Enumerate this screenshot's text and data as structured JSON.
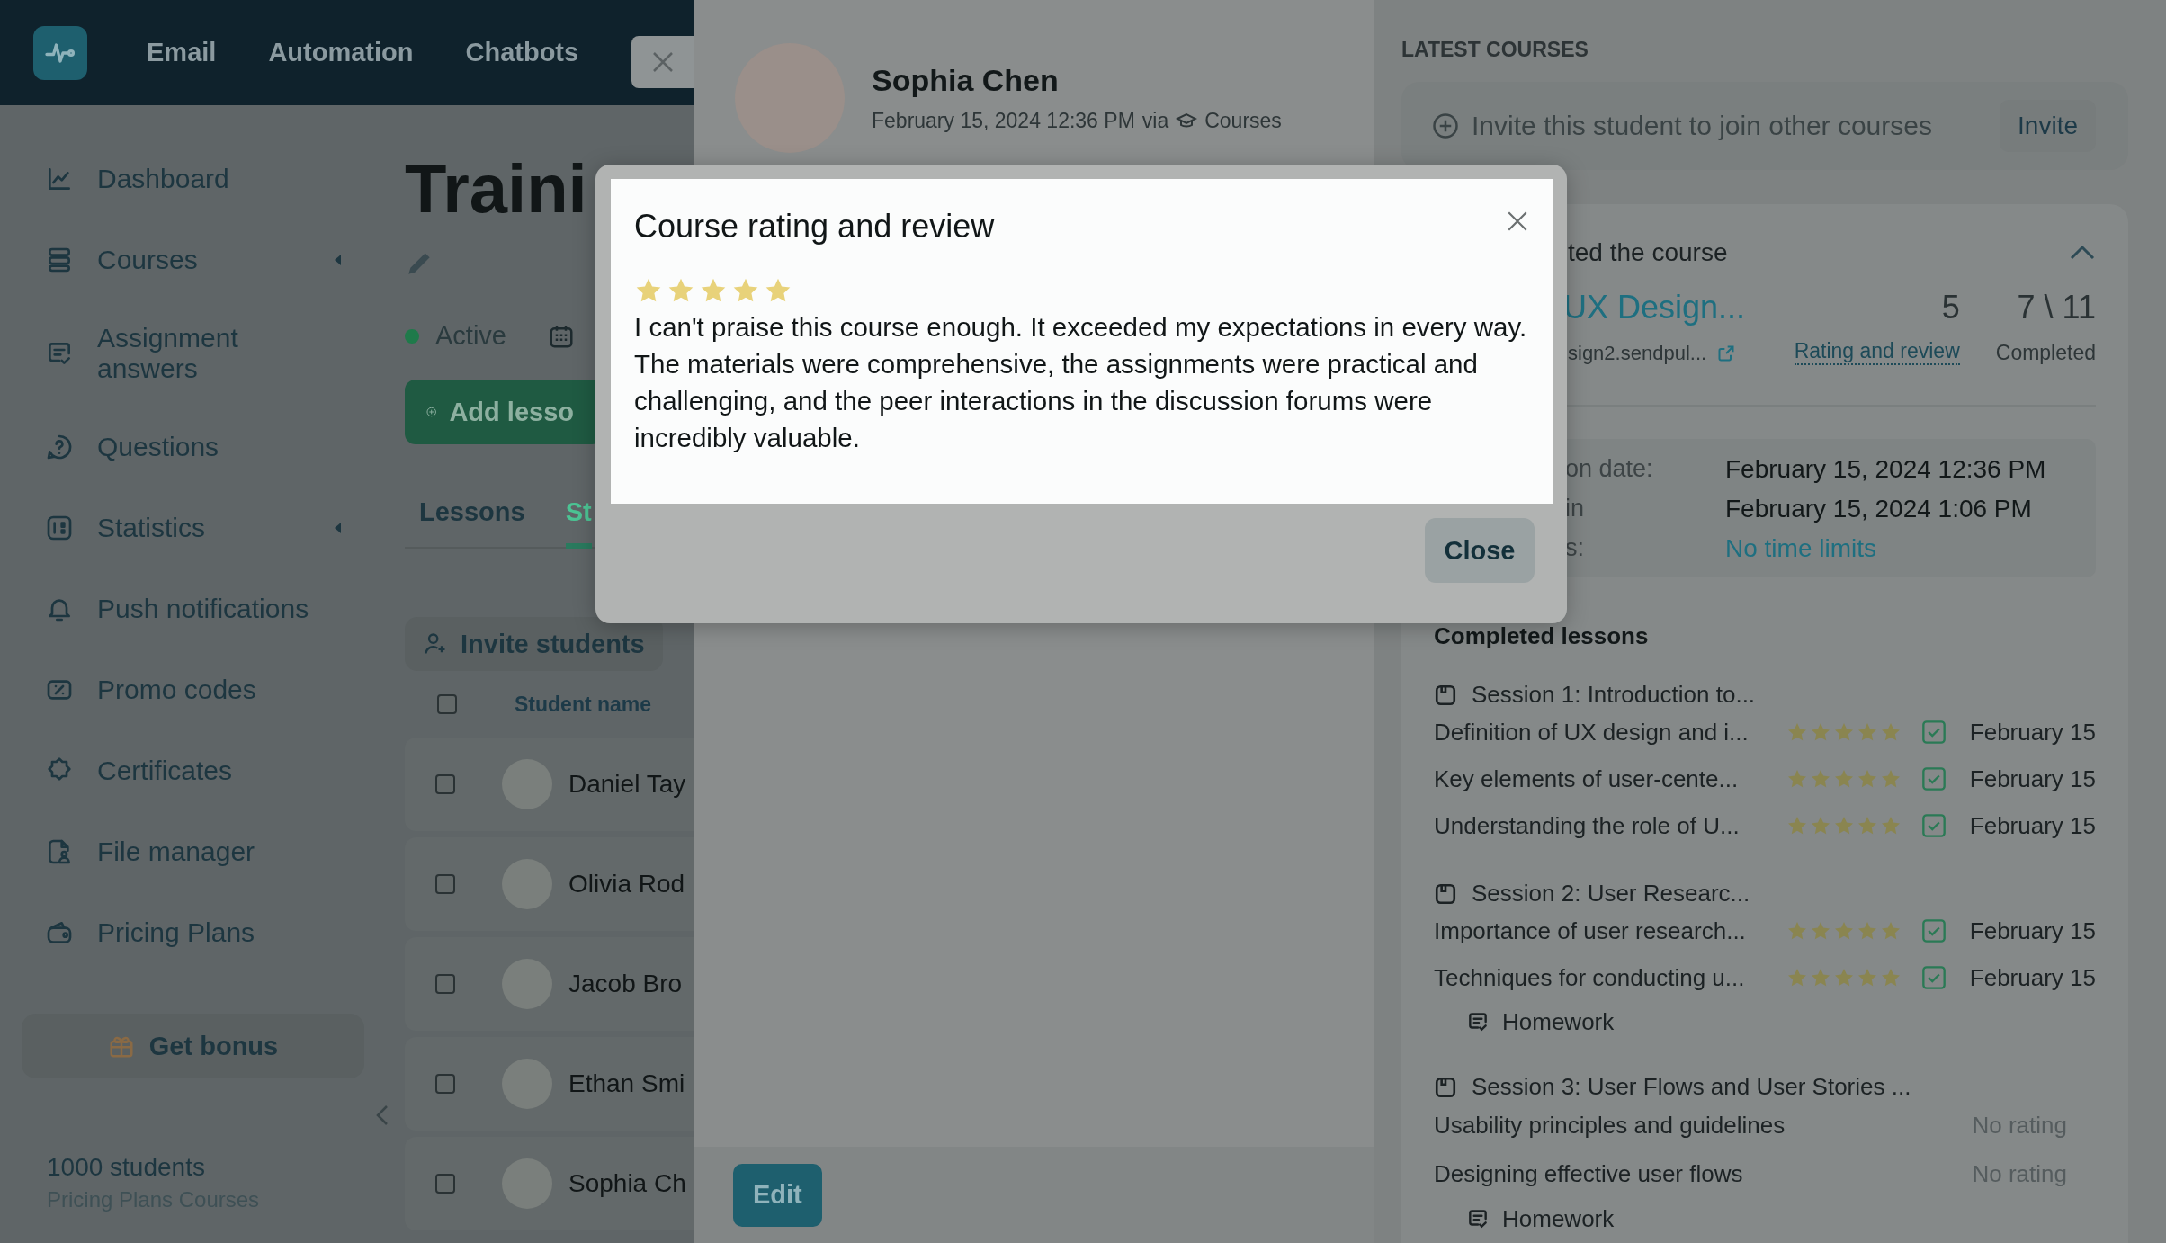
{
  "top_nav": {
    "items": [
      {
        "label": "Email"
      },
      {
        "label": "Automation"
      },
      {
        "label": "Chatbots"
      }
    ]
  },
  "sidebar": {
    "items": [
      {
        "label": "Dashboard",
        "expandable": false
      },
      {
        "label": "Courses",
        "expandable": true
      },
      {
        "label": "Assignment answers",
        "expandable": false
      },
      {
        "label": "Questions",
        "expandable": false
      },
      {
        "label": "Statistics",
        "expandable": true
      },
      {
        "label": "Push notifications",
        "expandable": false
      },
      {
        "label": "Promo codes",
        "expandable": false
      },
      {
        "label": "Certificates",
        "expandable": false
      },
      {
        "label": "File manager",
        "expandable": false
      },
      {
        "label": "Pricing Plans",
        "expandable": false
      }
    ],
    "bonus_button": "Get bonus",
    "footer": {
      "count": "1000 students",
      "plan": "Pricing Plans Courses"
    }
  },
  "course": {
    "title": "Traini",
    "status": "Active",
    "add_button": "Add lesso",
    "tabs": [
      {
        "label": "Lessons",
        "selected": false
      },
      {
        "label": "St",
        "selected": true
      }
    ],
    "invite_button": "Invite students",
    "table": {
      "header_checked": false,
      "columns": [
        "Student name"
      ],
      "rows": [
        {
          "name": "Daniel Tay",
          "checked": false
        },
        {
          "name": "Olivia Rod",
          "checked": false
        },
        {
          "name": "Jacob Bro",
          "checked": false
        },
        {
          "name": "Ethan Smi",
          "checked": false
        },
        {
          "name": "Sophia Ch",
          "checked": false
        }
      ]
    }
  },
  "student_panel": {
    "name": "Sophia Chen",
    "date": "February 15, 2024 12:36 PM",
    "via": "via",
    "source": "Courses",
    "edit_button": "Edit",
    "latest_courses": {
      "heading": "LATEST COURSES",
      "invite_text": "Invite this student to join other courses",
      "invite_button": "Invite",
      "course": {
        "status_text": "ted the course",
        "expanded": true,
        "name": "UX Design...",
        "link": "sign2.sendpul...",
        "rating": "5",
        "rating_label": "Rating and review",
        "progress": "7 \\ 11",
        "progress_label": "Completed",
        "details": [
          {
            "label": "on date:",
            "value": "February 15, 2024 12:36 PM",
            "kind": "text"
          },
          {
            "label": "in",
            "value": "February 15, 2024 1:06 PM",
            "kind": "text"
          },
          {
            "label": "s:",
            "value": "No time limits",
            "kind": "link"
          }
        ],
        "completed_heading": "Completed lessons",
        "sessions": [
          {
            "title": "Session 1: Introduction to...",
            "children": [
              {
                "kind": "rated",
                "title": "Definition of UX design and i...",
                "stars": 5,
                "checked": true,
                "date": "February 15"
              },
              {
                "kind": "rated",
                "title": "Key elements of user-cente...",
                "stars": 5,
                "checked": true,
                "date": "February 15"
              },
              {
                "kind": "rated",
                "title": "Understanding the role of U...",
                "stars": 5,
                "checked": true,
                "date": "February 15"
              }
            ]
          },
          {
            "title": "Session 2: User Researc...",
            "children": [
              {
                "kind": "rated",
                "title": "Importance of user research...",
                "stars": 5,
                "checked": true,
                "date": "February 15"
              },
              {
                "kind": "rated",
                "title": "Techniques for conducting u...",
                "stars": 5,
                "checked": true,
                "date": "February 15"
              },
              {
                "kind": "homework",
                "title": "Homework"
              }
            ]
          },
          {
            "title": "Session 3: User Flows and User Stories ...",
            "children": [
              {
                "kind": "unrated",
                "title": "Usability principles and guidelines",
                "rating_text": "No rating"
              },
              {
                "kind": "unrated",
                "title": "Designing effective user flows",
                "rating_text": "No rating"
              },
              {
                "kind": "homework",
                "title": "Homework"
              }
            ]
          }
        ]
      }
    }
  },
  "modal": {
    "title": "Course rating and review",
    "stars": 5,
    "review": "I can't praise this course enough. It exceeded my expectations in every way. The materials were comprehensive, the assignments were practical and challenging, and the peer interactions in the discussion forums were incredibly valuable.",
    "close_button": "Close"
  }
}
